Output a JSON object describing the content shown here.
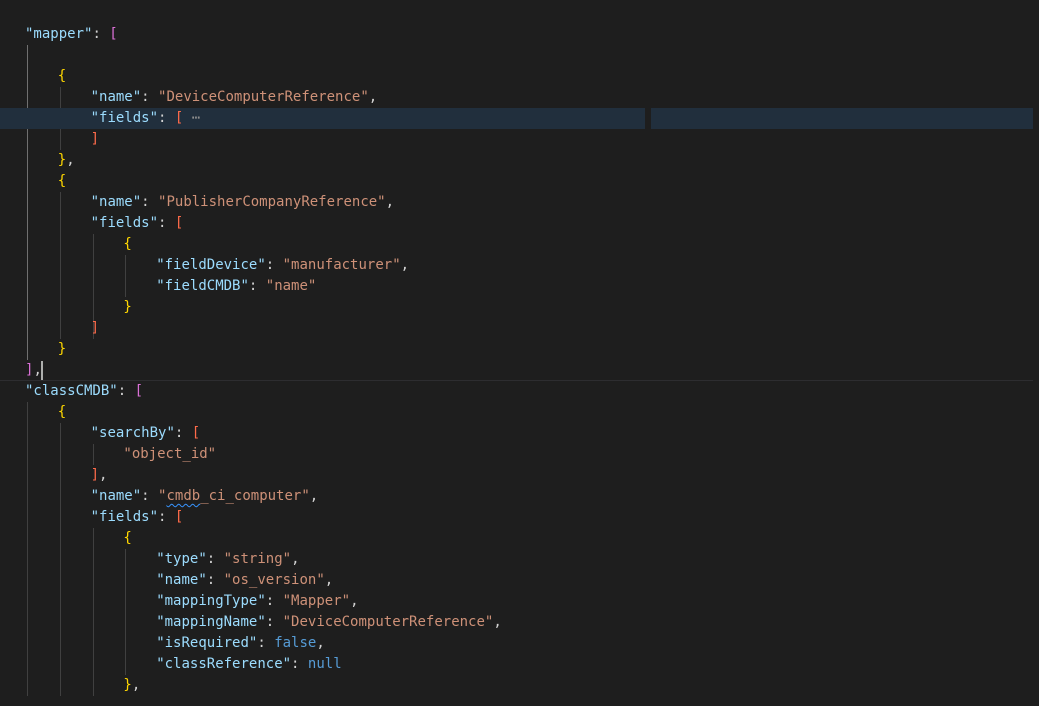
{
  "editor": {
    "lines": [
      {
        "tokens": [
          {
            "c": "k",
            "t": "\"mapper\""
          },
          {
            "c": "p",
            "t": ": "
          },
          {
            "c": "b1",
            "t": "["
          }
        ]
      },
      {
        "tokens": []
      },
      {
        "tokens": [
          {
            "c": "b2",
            "t": "{"
          }
        ]
      },
      {
        "tokens": [
          {
            "c": "k",
            "t": "\"name\""
          },
          {
            "c": "p",
            "t": ": "
          },
          {
            "c": "s",
            "t": "\"DeviceComputerReference\""
          },
          {
            "c": "p",
            "t": ","
          }
        ]
      },
      {
        "tokens": [
          {
            "c": "k",
            "t": "\"fields\""
          },
          {
            "c": "p",
            "t": ": "
          },
          {
            "c": "b3",
            "t": "["
          },
          {
            "c": "fold",
            "t": " ⋯"
          }
        ]
      },
      {
        "tokens": [
          {
            "c": "b3",
            "t": "]"
          }
        ]
      },
      {
        "tokens": [
          {
            "c": "b2",
            "t": "}"
          },
          {
            "c": "p",
            "t": ","
          }
        ]
      },
      {
        "tokens": [
          {
            "c": "b2",
            "t": "{"
          }
        ]
      },
      {
        "tokens": [
          {
            "c": "k",
            "t": "\"name\""
          },
          {
            "c": "p",
            "t": ": "
          },
          {
            "c": "s",
            "t": "\"PublisherCompanyReference\""
          },
          {
            "c": "p",
            "t": ","
          }
        ]
      },
      {
        "tokens": [
          {
            "c": "k",
            "t": "\"fields\""
          },
          {
            "c": "p",
            "t": ": "
          },
          {
            "c": "b3",
            "t": "["
          }
        ]
      },
      {
        "tokens": [
          {
            "c": "b2",
            "t": "{"
          }
        ]
      },
      {
        "tokens": [
          {
            "c": "k",
            "t": "\"fieldDevice\""
          },
          {
            "c": "p",
            "t": ": "
          },
          {
            "c": "s",
            "t": "\"manufacturer\""
          },
          {
            "c": "p",
            "t": ","
          }
        ]
      },
      {
        "tokens": [
          {
            "c": "k",
            "t": "\"fieldCMDB\""
          },
          {
            "c": "p",
            "t": ": "
          },
          {
            "c": "s",
            "t": "\"name\""
          }
        ]
      },
      {
        "tokens": [
          {
            "c": "b2",
            "t": "}"
          }
        ]
      },
      {
        "tokens": [
          {
            "c": "b3",
            "t": "]"
          }
        ]
      },
      {
        "tokens": [
          {
            "c": "b2",
            "t": "}"
          }
        ]
      },
      {
        "tokens": [
          {
            "c": "b1",
            "t": "]"
          },
          {
            "c": "p",
            "t": ","
          }
        ]
      },
      {
        "tokens": [
          {
            "c": "k",
            "t": "\"classCMDB\""
          },
          {
            "c": "p",
            "t": ": "
          },
          {
            "c": "b1",
            "t": "["
          }
        ]
      },
      {
        "tokens": [
          {
            "c": "b2",
            "t": "{"
          }
        ]
      },
      {
        "tokens": [
          {
            "c": "k",
            "t": "\"searchBy\""
          },
          {
            "c": "p",
            "t": ": "
          },
          {
            "c": "b3",
            "t": "["
          }
        ]
      },
      {
        "tokens": [
          {
            "c": "s",
            "t": "\"object_id\""
          }
        ]
      },
      {
        "tokens": [
          {
            "c": "b3",
            "t": "]"
          },
          {
            "c": "p",
            "t": ","
          }
        ]
      },
      {
        "tokens": [
          {
            "c": "k",
            "t": "\"name\""
          },
          {
            "c": "p",
            "t": ": "
          },
          {
            "c": "s",
            "t": "\""
          },
          {
            "c": "s squiggle",
            "t": "cmdb"
          },
          {
            "c": "s",
            "t": "_ci_computer\""
          },
          {
            "c": "p",
            "t": ","
          }
        ]
      },
      {
        "tokens": [
          {
            "c": "k",
            "t": "\"fields\""
          },
          {
            "c": "p",
            "t": ": "
          },
          {
            "c": "b3",
            "t": "["
          }
        ]
      },
      {
        "tokens": [
          {
            "c": "b2",
            "t": "{"
          }
        ]
      },
      {
        "tokens": [
          {
            "c": "k",
            "t": "\"type\""
          },
          {
            "c": "p",
            "t": ": "
          },
          {
            "c": "s",
            "t": "\"string\""
          },
          {
            "c": "p",
            "t": ","
          }
        ]
      },
      {
        "tokens": [
          {
            "c": "k",
            "t": "\"name\""
          },
          {
            "c": "p",
            "t": ": "
          },
          {
            "c": "s",
            "t": "\"os_version\""
          },
          {
            "c": "p",
            "t": ","
          }
        ]
      },
      {
        "tokens": [
          {
            "c": "k",
            "t": "\"mappingType\""
          },
          {
            "c": "p",
            "t": ": "
          },
          {
            "c": "s",
            "t": "\"Mapper\""
          },
          {
            "c": "p",
            "t": ","
          }
        ]
      },
      {
        "tokens": [
          {
            "c": "k",
            "t": "\"mappingName\""
          },
          {
            "c": "p",
            "t": ": "
          },
          {
            "c": "s",
            "t": "\"DeviceComputerReference\""
          },
          {
            "c": "p",
            "t": ","
          }
        ]
      },
      {
        "tokens": [
          {
            "c": "k",
            "t": "\"isRequired\""
          },
          {
            "c": "p",
            "t": ": "
          },
          {
            "c": "kw",
            "t": "false"
          },
          {
            "c": "p",
            "t": ","
          }
        ]
      },
      {
        "tokens": [
          {
            "c": "k",
            "t": "\"classReference\""
          },
          {
            "c": "p",
            "t": ": "
          },
          {
            "c": "kw",
            "t": "null"
          }
        ]
      },
      {
        "tokens": [
          {
            "c": "b2",
            "t": "}"
          },
          {
            "c": "p",
            "t": ","
          }
        ]
      }
    ]
  }
}
